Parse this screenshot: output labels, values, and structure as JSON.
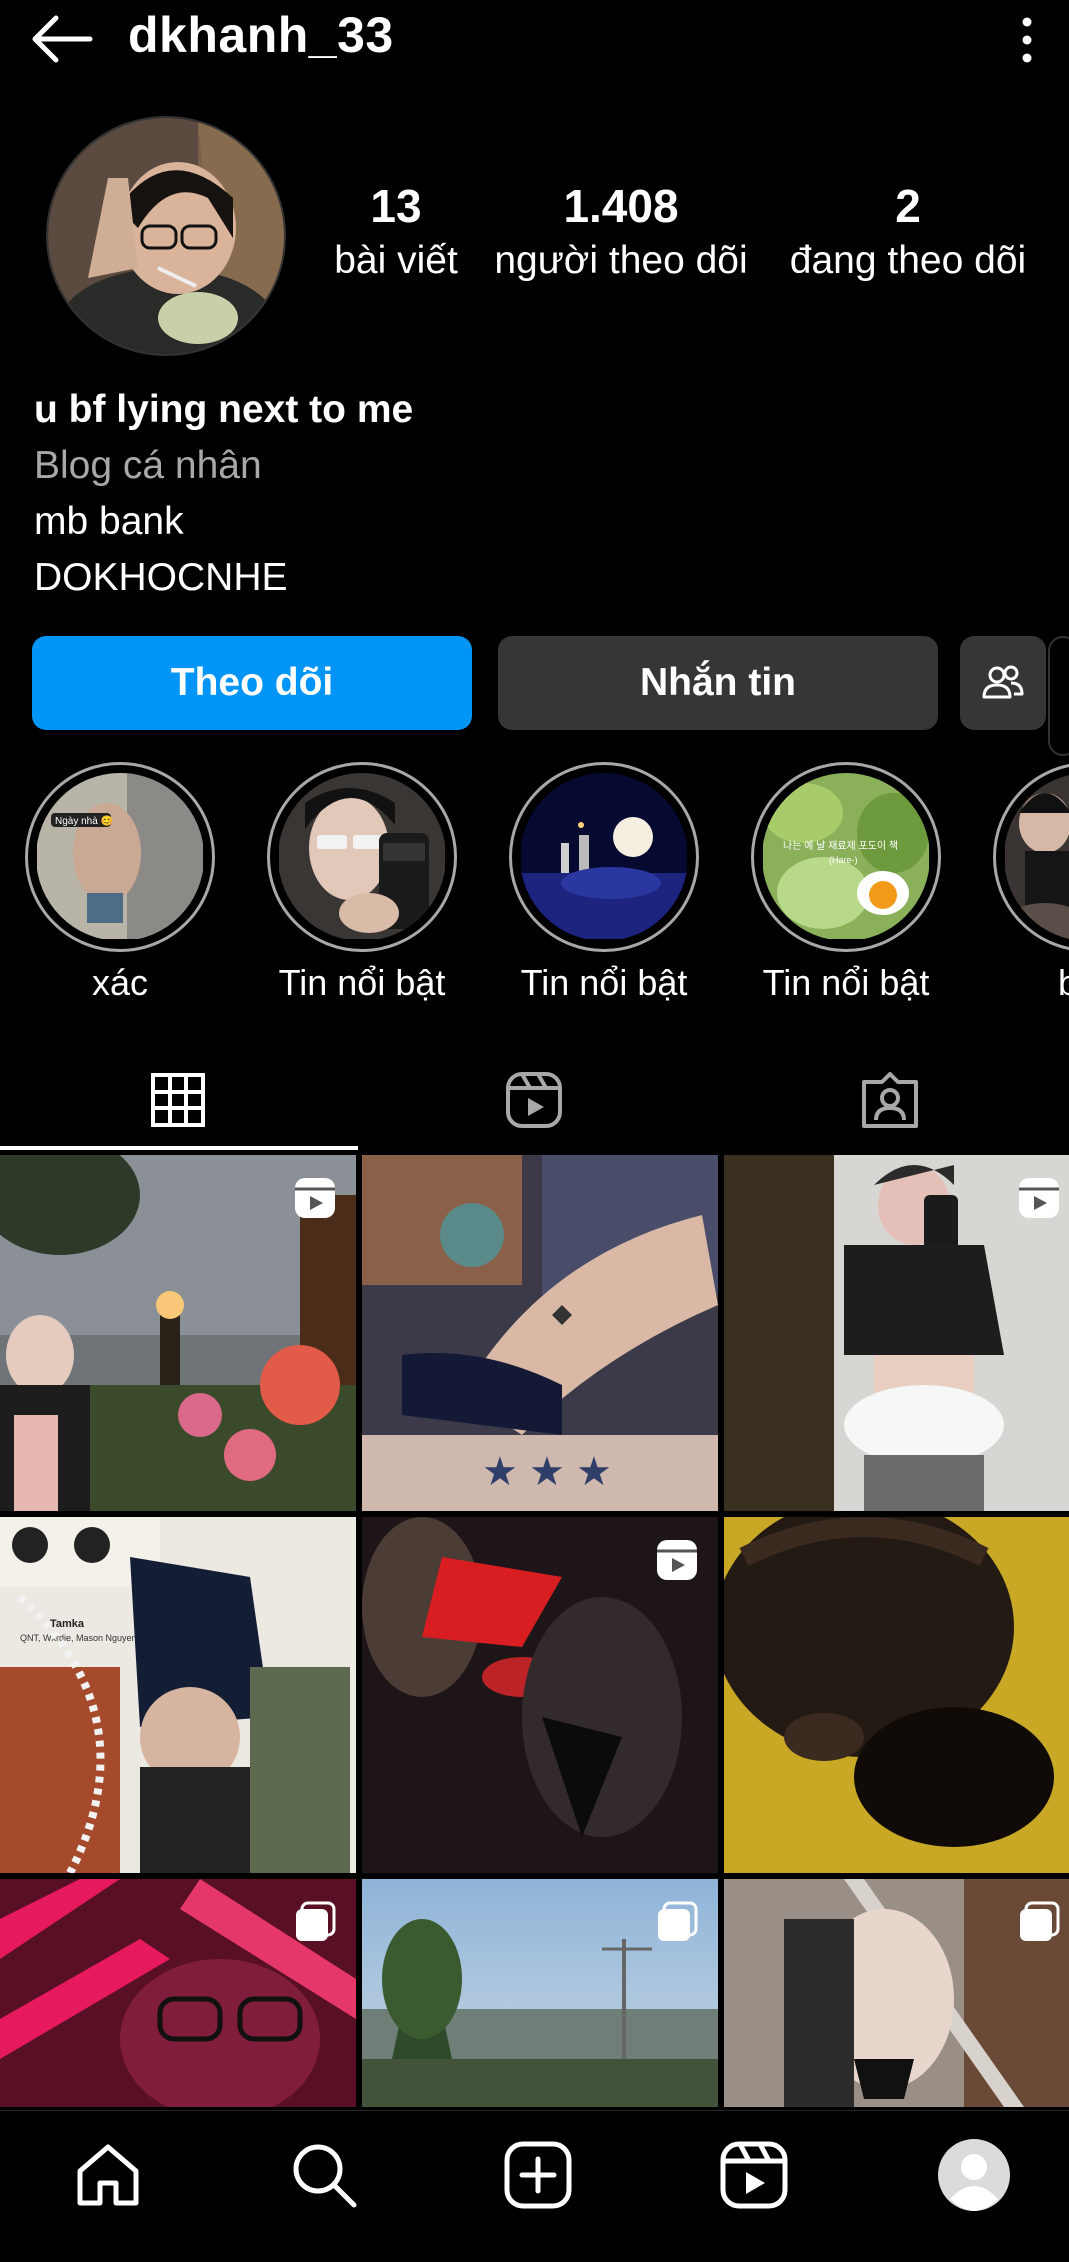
{
  "header": {
    "username": "dkhanh_33"
  },
  "stats": [
    {
      "value": "13",
      "label": "bài viết"
    },
    {
      "value": "1.408",
      "label": "người theo dõi"
    },
    {
      "value": "2",
      "label": "đang theo dõi"
    }
  ],
  "bio": {
    "name": "u bf lying next to me",
    "category": "Blog cá nhân",
    "line1": "mb bank",
    "line2": "DOKHOCNHE"
  },
  "buttons": {
    "follow": "Theo dõi",
    "message": "Nhắn tin"
  },
  "highlights": [
    {
      "label": "xác"
    },
    {
      "label": "Tin nổi bật"
    },
    {
      "label": "Tin nổi bật"
    },
    {
      "label": "Tin nổi bật"
    },
    {
      "label": "bán"
    }
  ],
  "highlight_texts": {
    "hl1": "Ngày nhà 😊",
    "hl4_line1": "나는 예 날 재료제 포도이 책",
    "hl4_line2": "(Hare-)"
  },
  "grid_text": {
    "post4_title": "Tamka",
    "post4_artists": "QNT, Wxrdie, Mason Nguyen"
  },
  "colors": {
    "accent": "#0095f6",
    "secondary_button": "#363636",
    "muted_text": "#a8a8a8",
    "background": "#000000"
  },
  "icons": {
    "header": [
      "back-arrow-icon",
      "more-options-icon"
    ],
    "tabs": [
      "grid-icon",
      "reels-icon",
      "tagged-icon"
    ],
    "nav": [
      "home-icon",
      "search-icon",
      "create-icon",
      "reels-icon",
      "profile-icon"
    ]
  }
}
